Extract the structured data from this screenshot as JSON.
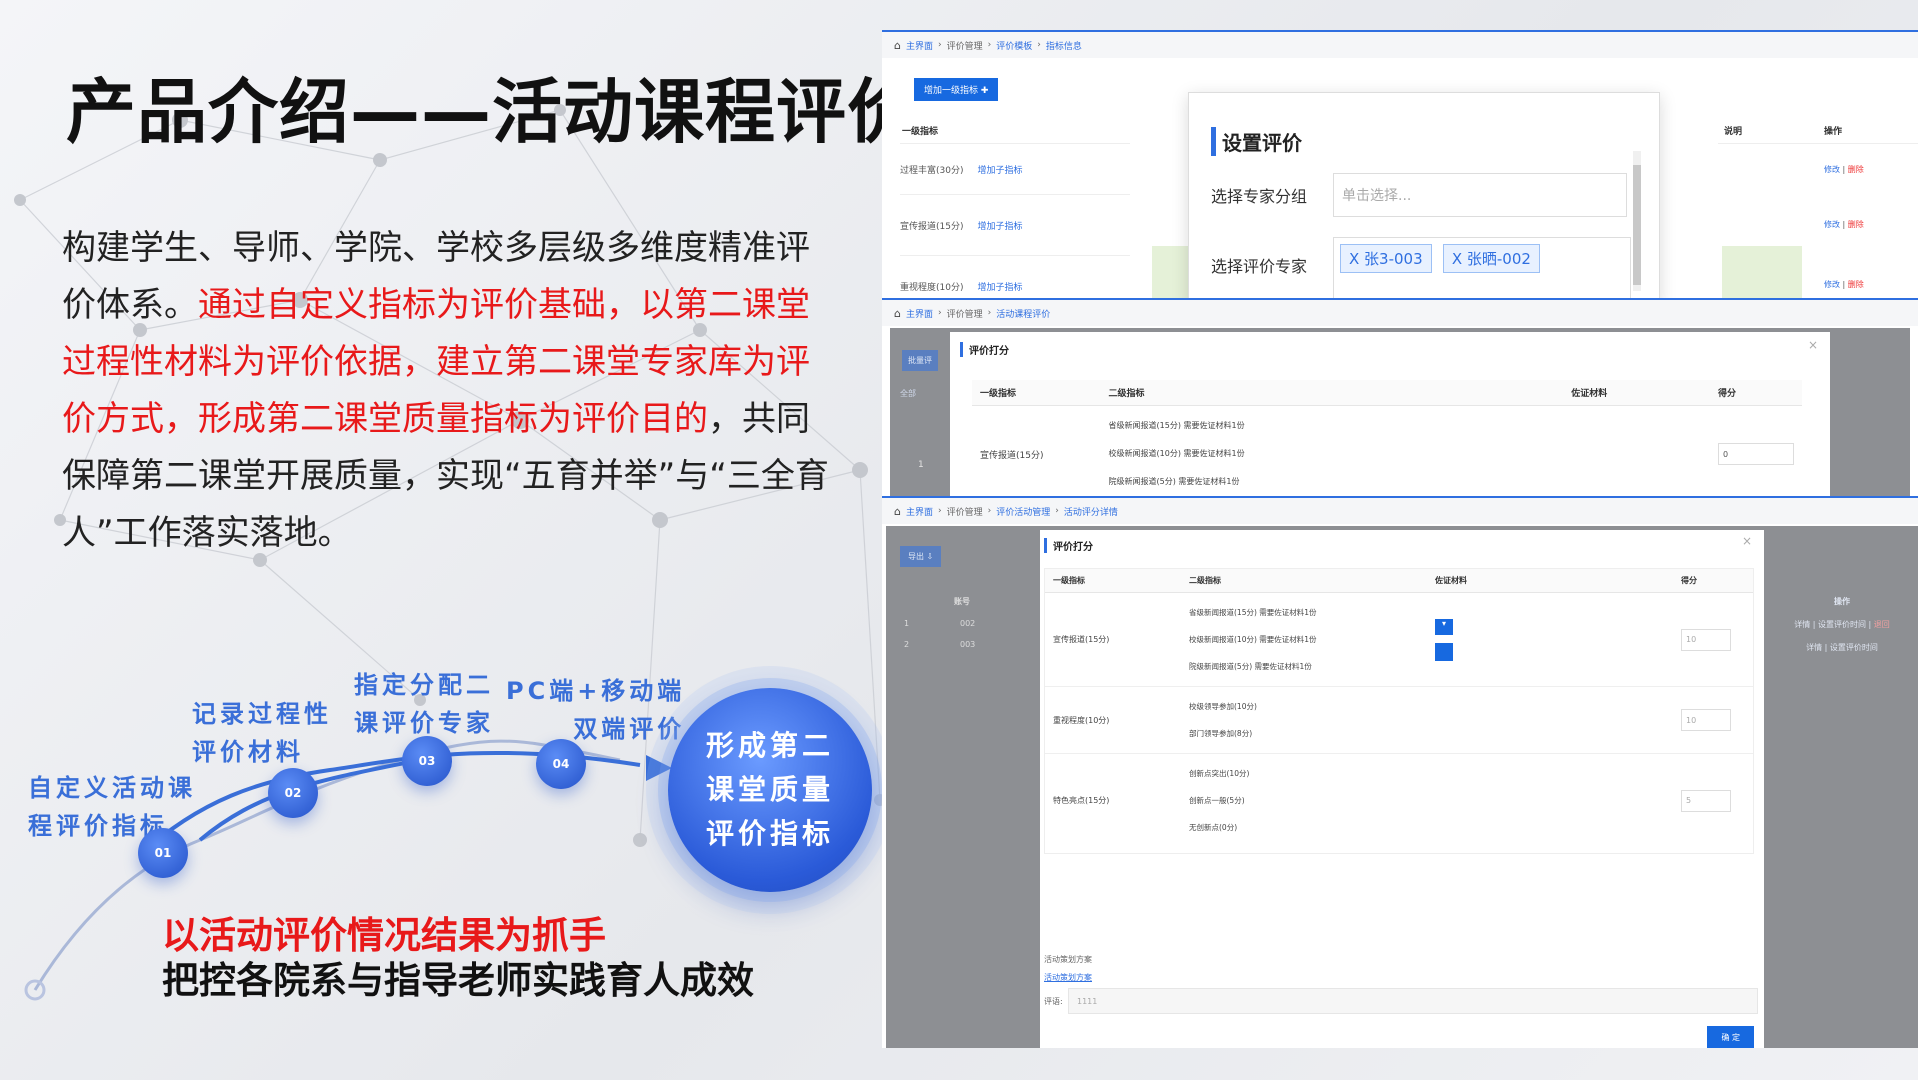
{
  "slide": {
    "title": "产品介绍——活动课程评价",
    "para_1": "构建学生、导师、学院、学校多层级多维度精准评价体系。",
    "para_red": "通过自定义指标为评价基础，以第二课堂过程性材料为评价依据，建立第二课堂专家库为评价方式，形成第二课堂质量指标为评价目的",
    "para_2": "，共同保障第二课堂开展质量，实现“五育并举”与“三全育人”工作落实落地。",
    "steps": [
      {
        "num": "01",
        "label_1": "自定义活动课",
        "label_2": "程评价指标"
      },
      {
        "num": "02",
        "label_1": "记录过程性",
        "label_2": "评价材料"
      },
      {
        "num": "03",
        "label_1": "指定分配二",
        "label_2": "课评价专家"
      },
      {
        "num": "04",
        "label_1": "PC端+移动端",
        "label_2": "双端评价"
      }
    ],
    "final": {
      "line_1": "形成第二",
      "line_2": "课堂质量",
      "line_3": "评价指标"
    },
    "slogan_red": "以活动评价情况结果为抓手",
    "slogan_black": "把控各院系与指导老师实践育人成效"
  },
  "shot1": {
    "breadcrumb": [
      "主界面",
      "评价管理",
      "评价模板",
      "指标信息"
    ],
    "add_button": "增加一级指标 ✚",
    "col_level1": "一级指标",
    "col_note": "说明",
    "col_ops": "操作",
    "rows": [
      {
        "name": "过程丰富(30分)",
        "add": "增加子指标",
        "edit": "修改",
        "del": "删除"
      },
      {
        "name": "宣传报道(15分)",
        "add": "增加子指标",
        "edit": "修改",
        "del": "删除"
      },
      {
        "name": "重视程度(10分)",
        "add": "增加子指标",
        "edit": "修改",
        "del": "删除"
      }
    ],
    "dialog_title": "设置评价",
    "group_label": "选择专家分组",
    "group_placeholder": "单击选择...",
    "expert_label": "选择评价专家",
    "experts": [
      "X 张3-003",
      "X 张晒-002"
    ]
  },
  "shot2": {
    "breadcrumb": [
      "主界面",
      "评价管理",
      "活动课程评价"
    ],
    "side_btn": "批量评",
    "side_tab": "全部",
    "row_num": "1",
    "dialog_title": "评价打分",
    "cols": [
      "一级指标",
      "二级指标",
      "佐证材料",
      "得分"
    ],
    "level1": "宣传报道(15分)",
    "items": [
      "省级新闻报道(15分) 需要佐证材料1份",
      "校级新闻报道(10分) 需要佐证材料1份",
      "院级新闻报道(5分) 需要佐证材料1份"
    ],
    "score": "0"
  },
  "shot3": {
    "breadcrumb": [
      "主界面",
      "评价管理",
      "评价活动管理",
      "活动评分详情"
    ],
    "export_btn": "导出 ⇩",
    "left_col": "账号",
    "left_rows": [
      {
        "n": "1",
        "id": "002"
      },
      {
        "n": "2",
        "id": "003"
      }
    ],
    "right_col": "操作",
    "right_rows": [
      {
        "a": "详情",
        "b": "设置评价时间",
        "c": "退回"
      },
      {
        "a": "详情",
        "b": "设置评价时间",
        "c": ""
      }
    ],
    "dialog_title": "评价打分",
    "cols": [
      "一级指标",
      "二级指标",
      "佐证材料",
      "得分"
    ],
    "groups": [
      {
        "level1": "宣传报道(15分)",
        "items": [
          "省级新闻报道(15分) 需要佐证材料1份",
          "校级新闻报道(10分) 需要佐证材料1份",
          "院级新闻报道(5分) 需要佐证材料1份"
        ],
        "score": "10"
      },
      {
        "level1": "重视程度(10分)",
        "items": [
          "校级领导参加(10分)",
          "部门领导参加(8分)"
        ],
        "score": "10"
      },
      {
        "level1": "特色亮点(15分)",
        "items": [
          "创新点突出(10分)",
          "创新点一般(5分)",
          "无创新点(0分)"
        ],
        "score": "5"
      }
    ],
    "plan_label": "活动策划方案",
    "plan_link": "活动策划方案",
    "comment_label": "评语:",
    "comment_value": "1111",
    "confirm": "确 定"
  }
}
